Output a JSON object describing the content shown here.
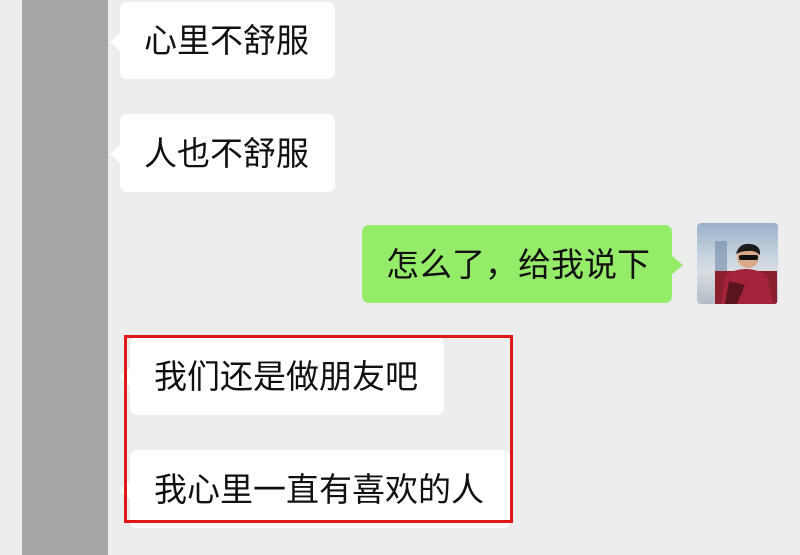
{
  "chat": {
    "messages": [
      {
        "side": "received",
        "text": "心里不舒服"
      },
      {
        "side": "received",
        "text": "人也不舒服"
      },
      {
        "side": "sent",
        "text": "怎么了，给我说下"
      },
      {
        "side": "received",
        "text": "我们还是做朋友吧"
      },
      {
        "side": "received",
        "text": "我心里一直有喜欢的人"
      }
    ]
  },
  "colors": {
    "background": "#ededed",
    "received_bubble": "#ffffff",
    "sent_bubble": "#95ec69",
    "highlight_box": "#e01818",
    "redaction_bar": "#a6a6a6"
  }
}
